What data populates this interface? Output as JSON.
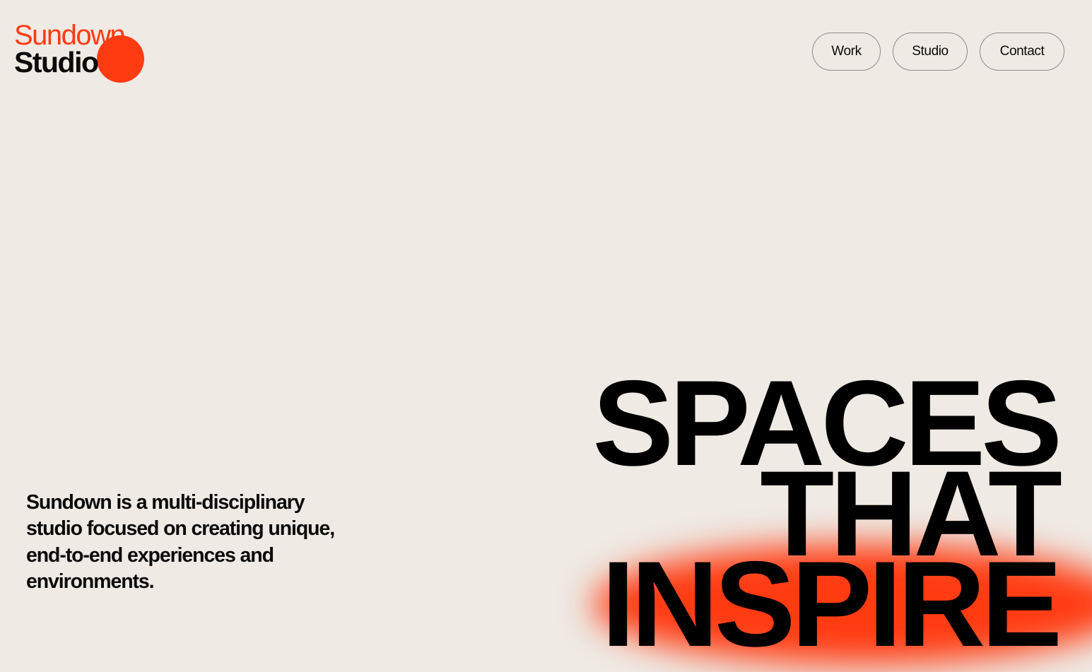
{
  "logo": {
    "line1": "Sundown",
    "line2": "Studio"
  },
  "nav": {
    "work": "Work",
    "studio": "Studio",
    "contact": "Contact"
  },
  "intro": {
    "text": "Sundown is a multi-disciplinary studio focused on creating unique, end-to-end experiences and environments."
  },
  "hero": {
    "line1": "SPACES",
    "line2": "THAT",
    "line3": "INSPIRE"
  },
  "colors": {
    "background": "#efeae4",
    "accent": "#ff3b12",
    "text": "#0a0a0a"
  }
}
